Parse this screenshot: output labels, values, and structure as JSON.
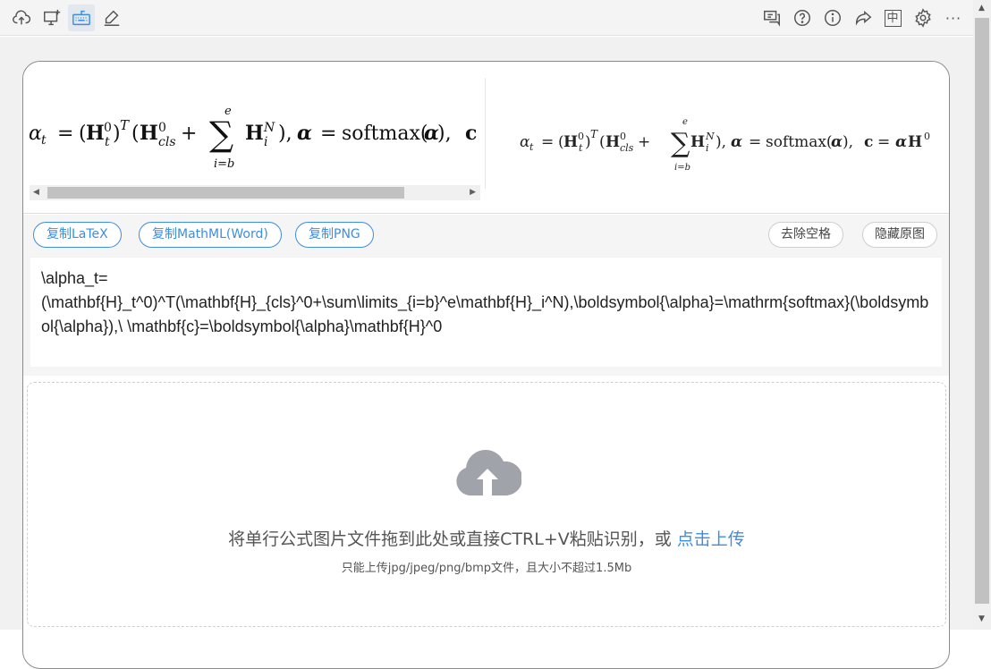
{
  "toolbar": {
    "left_icons": [
      "cloud-upload-icon",
      "screen-capture-icon",
      "keyboard-icon",
      "handwriting-icon"
    ],
    "right_icons": [
      "feedback-icon",
      "help-icon",
      "info-icon",
      "share-icon",
      "language-icon",
      "settings-icon",
      "more-icon"
    ],
    "language_label": "中",
    "more_label": "···"
  },
  "preview": {
    "formula_text": "αt = (H_t^0)^T (H_cls^0 + Σ_{i=b}^{e} H_i^N), α = softmax(α), c = αH^0"
  },
  "actions": {
    "copy_latex": "复制LaTeX",
    "copy_mathml": "复制MathML(Word)",
    "copy_png": "复制PNG",
    "remove_spaces": "去除空格",
    "hide_original": "隐藏原图"
  },
  "latex": {
    "value": "\\alpha_t=\n(\\mathbf{H}_t^0)^T(\\mathbf{H}_{cls}^0+\\sum\\limits_{i=b}^e\\mathbf{H}_i^N),\\boldsymbol{\\alpha}=\\mathrm{softmax}(\\boldsymbol{\\alpha}),\\ \\mathbf{c}=\\boldsymbol{\\alpha}\\mathbf{H}^0"
  },
  "upload": {
    "main_text": "将单行公式图片文件拖到此处或直接CTRL+V粘贴识别，或 ",
    "link_text": "点击上传",
    "sub_text": "只能上传jpg/jpeg/png/bmp文件，且大小不超过1.5Mb"
  },
  "colors": {
    "accent": "#3d8ee0",
    "cloud": "#a0a3aa"
  }
}
